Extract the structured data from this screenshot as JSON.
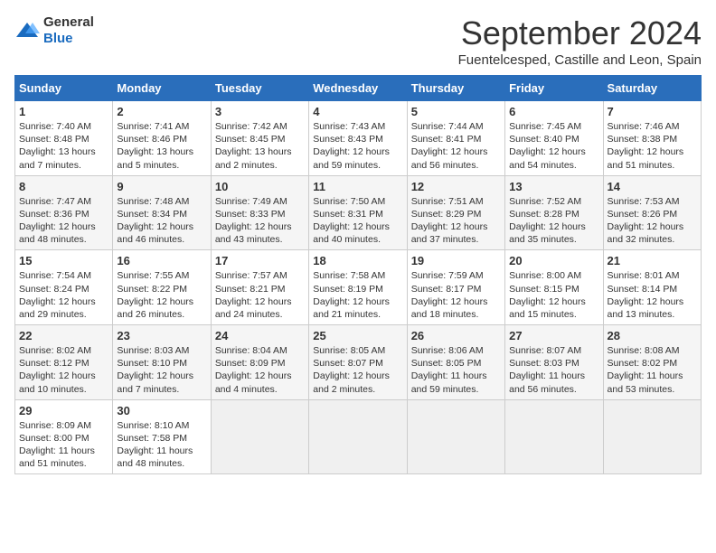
{
  "logo": {
    "general": "General",
    "blue": "Blue"
  },
  "header": {
    "month": "September 2024",
    "location": "Fuentelcesped, Castille and Leon, Spain"
  },
  "days_of_week": [
    "Sunday",
    "Monday",
    "Tuesday",
    "Wednesday",
    "Thursday",
    "Friday",
    "Saturday"
  ],
  "weeks": [
    [
      {
        "day": "1",
        "sunrise": "Sunrise: 7:40 AM",
        "sunset": "Sunset: 8:48 PM",
        "daylight": "Daylight: 13 hours and 7 minutes."
      },
      {
        "day": "2",
        "sunrise": "Sunrise: 7:41 AM",
        "sunset": "Sunset: 8:46 PM",
        "daylight": "Daylight: 13 hours and 5 minutes."
      },
      {
        "day": "3",
        "sunrise": "Sunrise: 7:42 AM",
        "sunset": "Sunset: 8:45 PM",
        "daylight": "Daylight: 13 hours and 2 minutes."
      },
      {
        "day": "4",
        "sunrise": "Sunrise: 7:43 AM",
        "sunset": "Sunset: 8:43 PM",
        "daylight": "Daylight: 12 hours and 59 minutes."
      },
      {
        "day": "5",
        "sunrise": "Sunrise: 7:44 AM",
        "sunset": "Sunset: 8:41 PM",
        "daylight": "Daylight: 12 hours and 56 minutes."
      },
      {
        "day": "6",
        "sunrise": "Sunrise: 7:45 AM",
        "sunset": "Sunset: 8:40 PM",
        "daylight": "Daylight: 12 hours and 54 minutes."
      },
      {
        "day": "7",
        "sunrise": "Sunrise: 7:46 AM",
        "sunset": "Sunset: 8:38 PM",
        "daylight": "Daylight: 12 hours and 51 minutes."
      }
    ],
    [
      {
        "day": "8",
        "sunrise": "Sunrise: 7:47 AM",
        "sunset": "Sunset: 8:36 PM",
        "daylight": "Daylight: 12 hours and 48 minutes."
      },
      {
        "day": "9",
        "sunrise": "Sunrise: 7:48 AM",
        "sunset": "Sunset: 8:34 PM",
        "daylight": "Daylight: 12 hours and 46 minutes."
      },
      {
        "day": "10",
        "sunrise": "Sunrise: 7:49 AM",
        "sunset": "Sunset: 8:33 PM",
        "daylight": "Daylight: 12 hours and 43 minutes."
      },
      {
        "day": "11",
        "sunrise": "Sunrise: 7:50 AM",
        "sunset": "Sunset: 8:31 PM",
        "daylight": "Daylight: 12 hours and 40 minutes."
      },
      {
        "day": "12",
        "sunrise": "Sunrise: 7:51 AM",
        "sunset": "Sunset: 8:29 PM",
        "daylight": "Daylight: 12 hours and 37 minutes."
      },
      {
        "day": "13",
        "sunrise": "Sunrise: 7:52 AM",
        "sunset": "Sunset: 8:28 PM",
        "daylight": "Daylight: 12 hours and 35 minutes."
      },
      {
        "day": "14",
        "sunrise": "Sunrise: 7:53 AM",
        "sunset": "Sunset: 8:26 PM",
        "daylight": "Daylight: 12 hours and 32 minutes."
      }
    ],
    [
      {
        "day": "15",
        "sunrise": "Sunrise: 7:54 AM",
        "sunset": "Sunset: 8:24 PM",
        "daylight": "Daylight: 12 hours and 29 minutes."
      },
      {
        "day": "16",
        "sunrise": "Sunrise: 7:55 AM",
        "sunset": "Sunset: 8:22 PM",
        "daylight": "Daylight: 12 hours and 26 minutes."
      },
      {
        "day": "17",
        "sunrise": "Sunrise: 7:57 AM",
        "sunset": "Sunset: 8:21 PM",
        "daylight": "Daylight: 12 hours and 24 minutes."
      },
      {
        "day": "18",
        "sunrise": "Sunrise: 7:58 AM",
        "sunset": "Sunset: 8:19 PM",
        "daylight": "Daylight: 12 hours and 21 minutes."
      },
      {
        "day": "19",
        "sunrise": "Sunrise: 7:59 AM",
        "sunset": "Sunset: 8:17 PM",
        "daylight": "Daylight: 12 hours and 18 minutes."
      },
      {
        "day": "20",
        "sunrise": "Sunrise: 8:00 AM",
        "sunset": "Sunset: 8:15 PM",
        "daylight": "Daylight: 12 hours and 15 minutes."
      },
      {
        "day": "21",
        "sunrise": "Sunrise: 8:01 AM",
        "sunset": "Sunset: 8:14 PM",
        "daylight": "Daylight: 12 hours and 13 minutes."
      }
    ],
    [
      {
        "day": "22",
        "sunrise": "Sunrise: 8:02 AM",
        "sunset": "Sunset: 8:12 PM",
        "daylight": "Daylight: 12 hours and 10 minutes."
      },
      {
        "day": "23",
        "sunrise": "Sunrise: 8:03 AM",
        "sunset": "Sunset: 8:10 PM",
        "daylight": "Daylight: 12 hours and 7 minutes."
      },
      {
        "day": "24",
        "sunrise": "Sunrise: 8:04 AM",
        "sunset": "Sunset: 8:09 PM",
        "daylight": "Daylight: 12 hours and 4 minutes."
      },
      {
        "day": "25",
        "sunrise": "Sunrise: 8:05 AM",
        "sunset": "Sunset: 8:07 PM",
        "daylight": "Daylight: 12 hours and 2 minutes."
      },
      {
        "day": "26",
        "sunrise": "Sunrise: 8:06 AM",
        "sunset": "Sunset: 8:05 PM",
        "daylight": "Daylight: 11 hours and 59 minutes."
      },
      {
        "day": "27",
        "sunrise": "Sunrise: 8:07 AM",
        "sunset": "Sunset: 8:03 PM",
        "daylight": "Daylight: 11 hours and 56 minutes."
      },
      {
        "day": "28",
        "sunrise": "Sunrise: 8:08 AM",
        "sunset": "Sunset: 8:02 PM",
        "daylight": "Daylight: 11 hours and 53 minutes."
      }
    ],
    [
      {
        "day": "29",
        "sunrise": "Sunrise: 8:09 AM",
        "sunset": "Sunset: 8:00 PM",
        "daylight": "Daylight: 11 hours and 51 minutes."
      },
      {
        "day": "30",
        "sunrise": "Sunrise: 8:10 AM",
        "sunset": "Sunset: 7:58 PM",
        "daylight": "Daylight: 11 hours and 48 minutes."
      },
      null,
      null,
      null,
      null,
      null
    ]
  ]
}
